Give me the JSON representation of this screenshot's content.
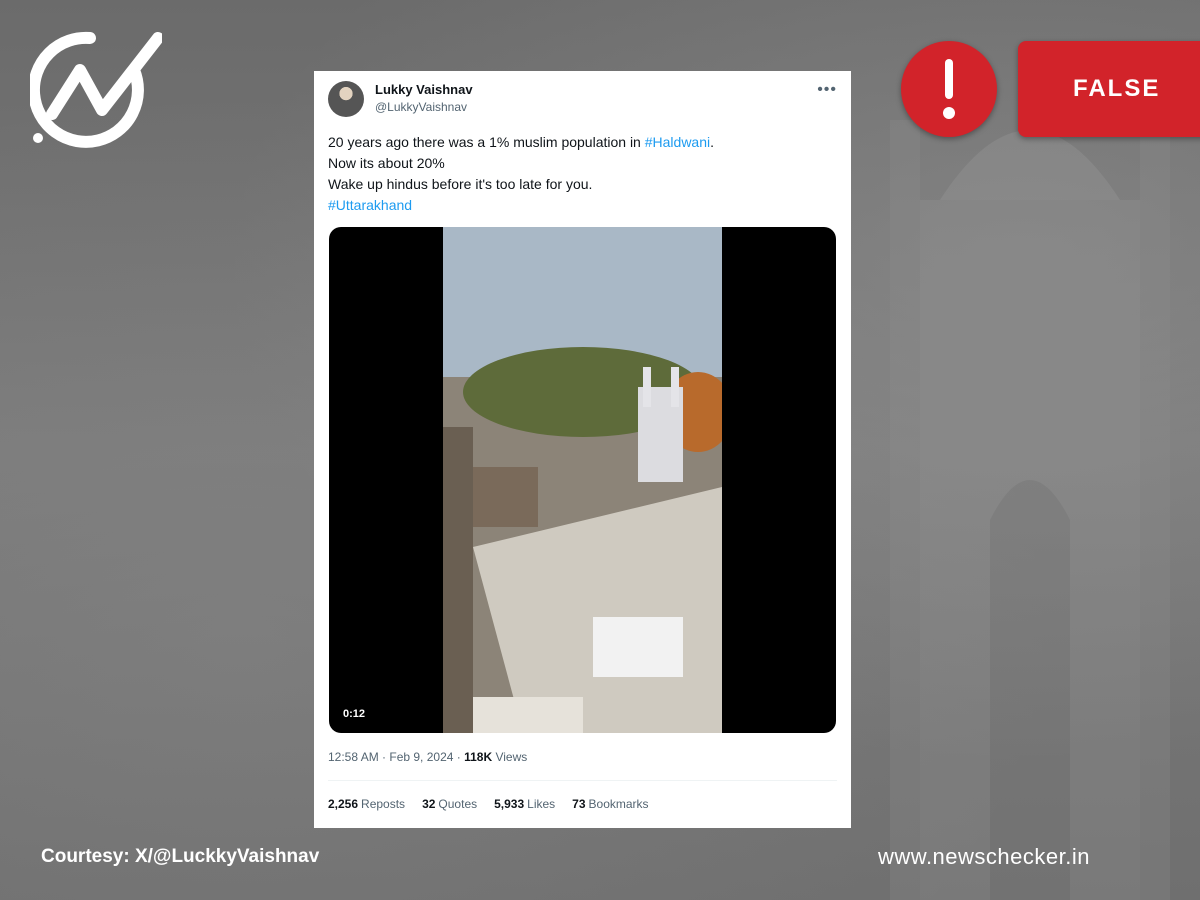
{
  "brand": {
    "logo_icon": "newschecker-check-logo-icon",
    "site": "www.newschecker.in"
  },
  "verdict": {
    "icon": "exclamation-icon",
    "label": "FALSE",
    "color": "#d2232a"
  },
  "tweet": {
    "author_name": "Lukky Vaishnav",
    "author_handle": "@LukkyVaishnav",
    "more_icon": "more-icon",
    "text": {
      "line1_prefix": "20 years ago there was a 1% muslim population in ",
      "line1_tag": "#Haldwani",
      "line1_suffix": ".",
      "line2": "Now its about 20%",
      "line3": "Wake up hindus before it's too late for you.",
      "line4_tag": "#Uttarakhand"
    },
    "video": {
      "duration": "0:12"
    },
    "meta": {
      "time_date": "12:58 AM · Feb 9, 2024 · ",
      "views_count": "118K",
      "views_label": " Views"
    },
    "stats": {
      "reposts_count": "2,256",
      "reposts_label": "Reposts",
      "quotes_count": "32",
      "quotes_label": "Quotes",
      "likes_count": "5,933",
      "likes_label": "Likes",
      "bookmarks_count": "73",
      "bookmarks_label": "Bookmarks"
    }
  },
  "courtesy": "Courtesy: X/@LuckkyVaishnav"
}
